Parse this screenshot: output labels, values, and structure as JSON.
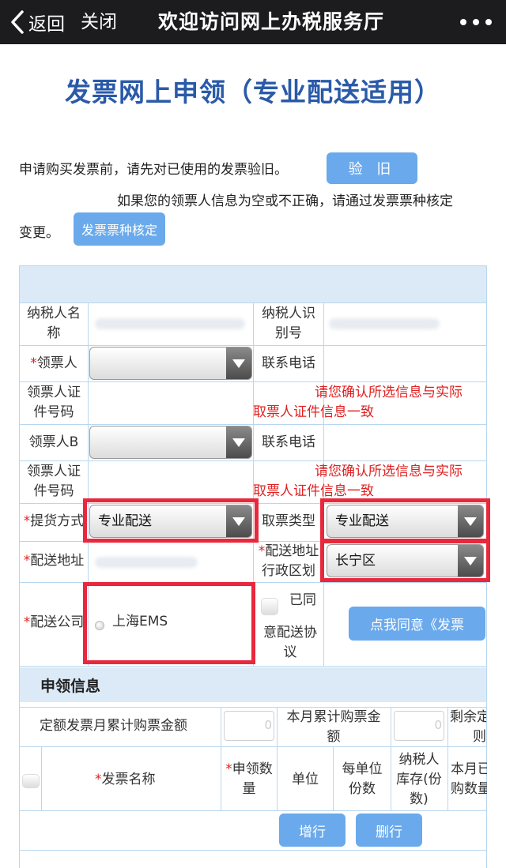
{
  "topbar": {
    "back_label": "返回",
    "close_label": "关闭",
    "title": "欢迎访问网上办税服务厅"
  },
  "page_title": "发票网上申领（专业配送适用）",
  "notices": {
    "verify_text": "申请购买发票前，请先对已使用的发票验旧。",
    "verify_button": "验 旧",
    "core_text_1": "如果您的领票人信息为空或不正确，请通过发票票种核定",
    "core_text_2": "变更。",
    "core_button": "发票票种核定"
  },
  "form": {
    "taxpayer_name_label_1": "纳税人名",
    "taxpayer_name_label_2": "称",
    "taxpayer_id_label_1": "纳税人识",
    "taxpayer_id_label_2": "别号",
    "required_mark": "*",
    "collector_label": "领票人",
    "phone_label": "联系电话",
    "collector_id_label_1": "领票人证",
    "collector_id_label_2": "件号码",
    "warning_1": "请您确认所选信息与实际",
    "warning_2": "取票人证件信息一致",
    "collector_b_label": "领票人B",
    "phone_label_b": "联系电话",
    "collector_b_id_label_1": "领票人证",
    "collector_b_id_label_2": "件号码",
    "warning_b_1": "请您确认所选信息与实际",
    "warning_b_2": "取票人证件信息一致",
    "pickup_method_label": "提货方式",
    "pickup_method_value": "专业配送",
    "ticket_type_label": "取票类型",
    "ticket_type_value": "专业配送",
    "delivery_address_label": "配送地址",
    "delivery_region_label_1": "配送地址",
    "delivery_region_label_2": "行政区划",
    "delivery_region_value": "长宁区",
    "delivery_company_label": "配送公司",
    "delivery_company_option": "上海EMS",
    "agree_label_1": "已同",
    "agree_label_2": "意配送协",
    "agree_label_3": "议",
    "agree_button": "点我同意《发票"
  },
  "apply_section": {
    "title": "申领信息",
    "quota_amount_label": "定额发票月累计购票金额",
    "quota_amount_value": "0",
    "month_total_label_1": "本月累计购票金",
    "month_total_label_2": "额",
    "month_total_value": "0",
    "remaining_label_1": "剩余定",
    "remaining_label_2": "则",
    "columns": {
      "invoice_name": "发票名称",
      "apply_qty_1": "申领数",
      "apply_qty_2": "量",
      "unit": "单位",
      "per_unit_1": "每单位",
      "per_unit_2": "份数",
      "stock_1": "纳税人",
      "stock_2": "库存(份",
      "stock_3": "数)",
      "month_bought_1": "本月已",
      "month_bought_2": "购数量"
    },
    "add_row_button": "增行",
    "delete_row_button": "删行"
  }
}
